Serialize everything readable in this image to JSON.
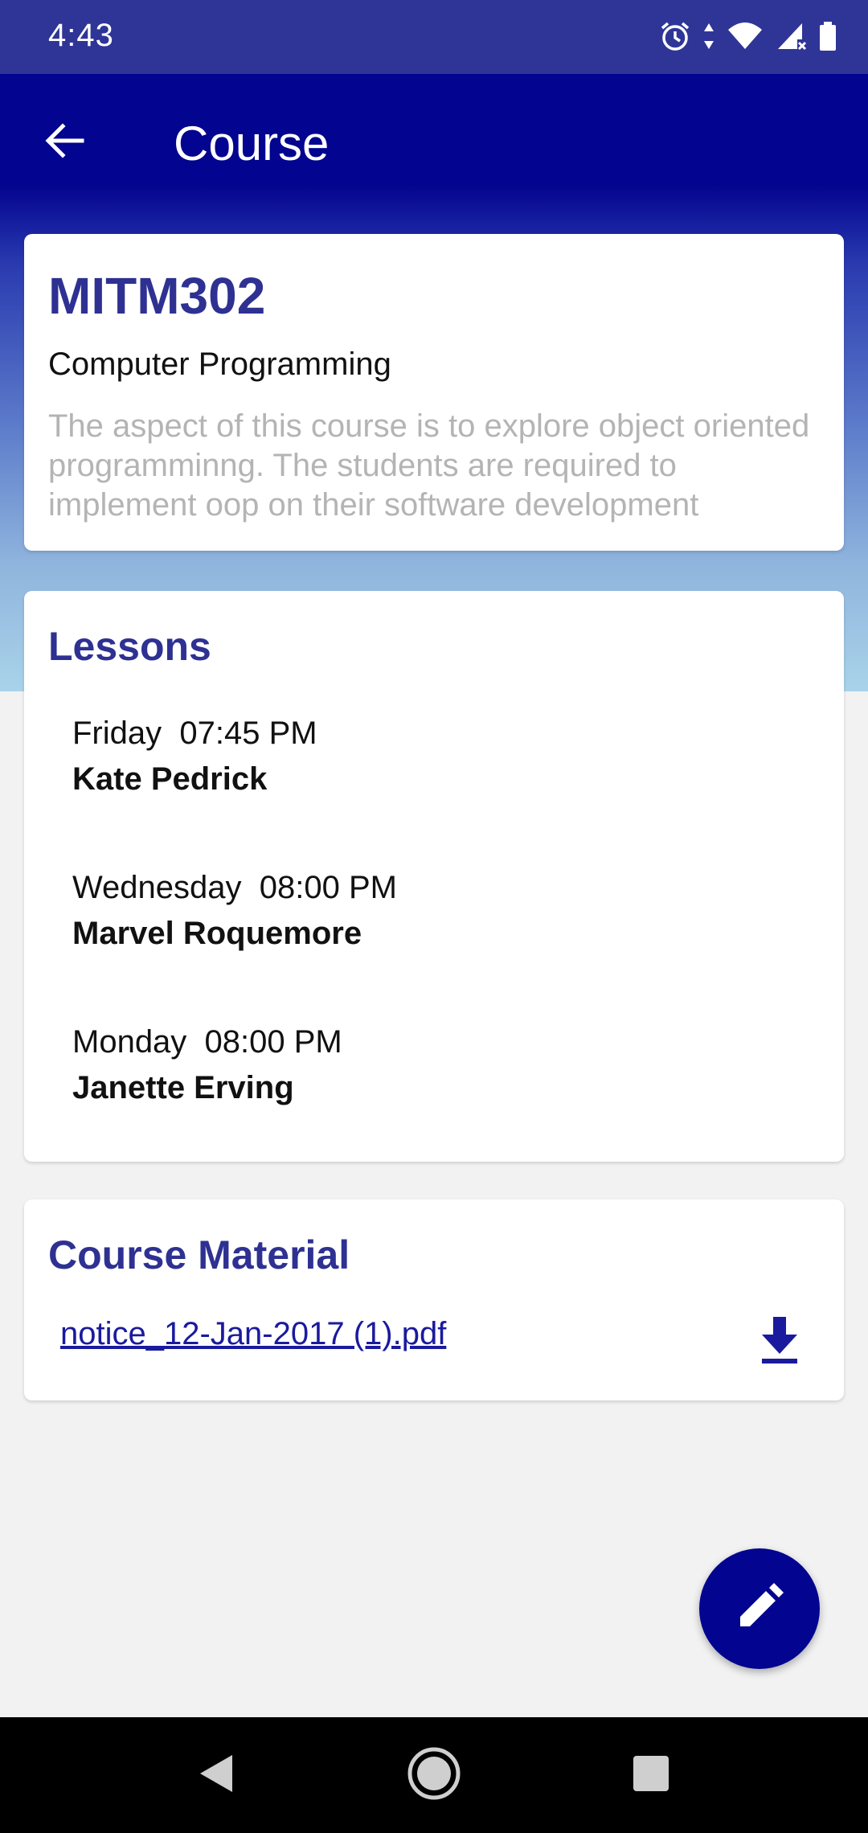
{
  "status_bar": {
    "time": "4:43",
    "icons": [
      "alarm-icon",
      "data-arrows-icon",
      "wifi-icon",
      "signal-icon",
      "battery-icon"
    ]
  },
  "app_bar": {
    "title": "Course",
    "back_icon": "arrow-back-icon"
  },
  "course": {
    "code": "MITM302",
    "name": "Computer Programming",
    "description": "The aspect of this course is to explore object oriented programminng. The students are required to implement oop on their software development"
  },
  "lessons": {
    "title": "Lessons",
    "items": [
      {
        "when": "Friday  07:45 PM",
        "teacher": "Kate Pedrick"
      },
      {
        "when": "Wednesday  08:00 PM",
        "teacher": "Marvel Roquemore"
      },
      {
        "when": "Monday  08:00 PM",
        "teacher": "Janette Erving"
      }
    ]
  },
  "material": {
    "title": "Course Material",
    "file_name": "notice_12-Jan-2017 (1).pdf",
    "download_icon": "download-icon"
  },
  "fab": {
    "icon": "edit-pencil-icon"
  },
  "nav_bar": {
    "icons": [
      "back-triangle-icon",
      "home-circle-icon",
      "recents-square-icon"
    ]
  },
  "colors": {
    "primary": "#03048f",
    "status_bar": "#2f3596",
    "heading": "#2e3192",
    "muted_text": "#b4b4b4",
    "link": "#1a1a9e",
    "background": "#f2f2f2"
  }
}
